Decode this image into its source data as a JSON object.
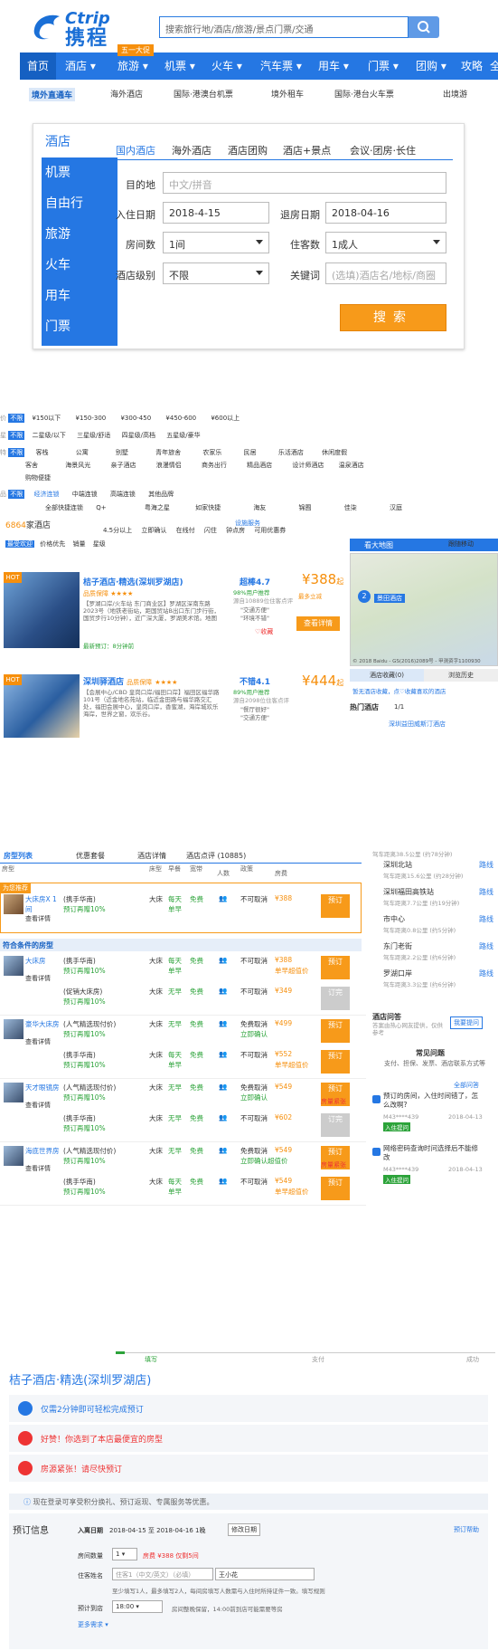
{
  "header": {
    "logo_en": "Ctrip",
    "logo_cn": "携程",
    "search_placeholder": "搜索旅行地/酒店/旅游/景点门票/交通"
  },
  "nav": {
    "items": [
      "首页",
      "酒店",
      "旅游",
      "机票",
      "火车",
      "汽车票",
      "用车",
      "门票",
      "团购",
      "攻略",
      "全"
    ],
    "badge": "五一大促"
  },
  "subnav": {
    "items": [
      "境外直通车",
      "海外酒店",
      "国际·港澳台机票",
      "境外租车",
      "国际·港台火车票",
      "出境游"
    ]
  },
  "search_panel": {
    "side": [
      "酒店",
      "机票",
      "自由行",
      "旅游",
      "火车",
      "用车",
      "门票"
    ],
    "tabs": [
      "国内酒店",
      "海外酒店",
      "酒店团购",
      "酒店+景点",
      "会议·团房·长住"
    ],
    "dest_label": "目的地",
    "dest_placeholder": "中文/拼音",
    "checkin_label": "入住日期",
    "checkin": "2018-4-15",
    "checkout_label": "退房日期",
    "checkout": "2018-04-16",
    "rooms_label": "房间数",
    "rooms": "1间",
    "guests_label": "住客数",
    "guests": "1成人",
    "level_label": "酒店级别",
    "level": "不限",
    "keyword_label": "关键词",
    "keyword_placeholder": "(选填)酒店名/地标/商圈",
    "button": "搜索"
  },
  "filters": {
    "price": [
      "不限",
      "¥150以下",
      "¥150-300",
      "¥300-450",
      "¥450-600",
      "¥600以上"
    ],
    "star": [
      "不限",
      "二星级/以下",
      "三星级/舒适",
      "四星级/高档",
      "五星级/豪华"
    ],
    "feature_row1": [
      "不限",
      "客栈",
      "公寓",
      "别墅",
      "青年旅舍",
      "农家乐",
      "民居",
      "乐活酒店",
      "休闲度假"
    ],
    "feature_row2": [
      "客舍",
      "海景风光",
      "亲子酒店",
      "浪漫情侣",
      "商务出行",
      "精品酒店",
      "设计师酒店",
      "温泉酒店"
    ],
    "feature_row3": [
      "购物便捷"
    ],
    "brand_tabs": [
      "不限",
      "经济连锁",
      "中端连锁",
      "高端连锁",
      "其他品牌"
    ],
    "brand_row": [
      "全部快捷连锁",
      "Q+",
      "粤海之星",
      "如家快捷",
      "海友",
      "锦囿",
      "佳柒",
      "汉庭"
    ],
    "count": "6864",
    "count_suffix": "家酒店",
    "more": "设施服务",
    "sortbar": [
      "4.5分以上",
      "立即确认",
      "在线付",
      "闪住",
      "钟点房",
      "可用优惠券"
    ],
    "top_tabs": [
      "最受欢迎",
      "价格优先",
      "销量",
      "星级"
    ]
  },
  "hotels": [
    {
      "name": "桔子酒店·精选(深圳罗湖店)",
      "tag": "品质保障",
      "stars": "★★★★",
      "addr": "【罗湖口岸/火车站 东门商业区】罗湖区深南东路2023号（地铁老街站，距国贸站B出口东门步行街，国贸步行10分钟），近广深大厦，罗湖美术馆。地图",
      "score_label": "超棒",
      "score": "4.7",
      "rec": "98%用户推荐",
      "reviews": "源自10889位住客点评",
      "quote1": "\"交通方便\"",
      "quote2": "\"环境不错\"",
      "price": "388",
      "price_sfx": "起",
      "coupon": "最多立减",
      "button": "查看详情",
      "fav": "收藏",
      "recent": "最新预订：8分钟前"
    },
    {
      "name": "深圳驿酒店",
      "tag": "品质保障",
      "stars": "★★★★",
      "addr": "【会展中心/CBD 皇岗口岸/福田口岸】福田区福华路101号（近金地名苑站，临近金田路与福华路交汇处，福田会展中心，皇岗口岸，香蜜湖，海岸城欢乐海岸，世界之窗，欢乐谷。",
      "score_label": "不错",
      "score": "4.1",
      "rec": "89%用户推荐",
      "reviews": "源自2098位住客点评",
      "quote1": "\"餐厅很好\"",
      "quote2": "\"交通方便\"",
      "price": "444",
      "price_sfx": "起"
    }
  ],
  "map": {
    "label": "看大地图",
    "place": "景田酒店",
    "follow": "跟随移动",
    "copyright": "© 2018 Baidu - GS(2016)2089号 - 甲测资字1100930",
    "recent_tab": "酒店收藏(0)",
    "history_tab": "浏览历史",
    "empty": "暂无酒店收藏，点♡收藏喜欢的酒店",
    "hot": "热门酒店",
    "hotpage": "1/1",
    "hot_item": "深圳益田威斯汀酒店"
  },
  "detail": {
    "tabs": [
      "房型列表",
      "优惠套餐",
      "酒店详情",
      "酒店点评 (10885)"
    ],
    "cols": [
      "房型",
      "床型",
      "早餐",
      "宽带",
      "人数",
      "政策",
      "房费"
    ],
    "featured_tag": "为您推荐",
    "featured": {
      "room": "大床房X 1间",
      "look": "查看详情",
      "src": "(携手华南)",
      "note": "预订再赠10%",
      "bed": "大床",
      "breakfast": "每天单早",
      "wifi": "免费",
      "policy": "不可取消",
      "price": "¥388",
      "btn": "预订"
    },
    "section": "符合条件的房型",
    "rooms": [
      {
        "room": "大床房",
        "look": "查看详情",
        "rows": [
          {
            "src": "(携手华南)",
            "note": "预订再赠10%",
            "bed": "大床",
            "breakfast": "每天单早",
            "wifi": "免费",
            "policy": "不可取消",
            "price": "¥388",
            "sub": "单早超值价",
            "btn": "预订",
            "gray": false
          },
          {
            "src": "(促销大床房)",
            "note": "预订再赠10%",
            "bed": "大床",
            "breakfast": "无早",
            "wifi": "免费",
            "policy": "不可取消",
            "price": "¥349",
            "sub": "",
            "btn": "订完",
            "gray": true
          }
        ]
      },
      {
        "room": "豪华大床房",
        "look": "查看详情",
        "rows": [
          {
            "src": "(人气精选现付价)",
            "note": "预订再赠10%",
            "bed": "大床",
            "breakfast": "无早",
            "wifi": "免费",
            "policy": "免费取消",
            "sub2": "立即确认",
            "price": "¥499",
            "sub": "",
            "btn": "预订",
            "gray": false
          },
          {
            "src": "(携手华南)",
            "note": "预订再赠10%",
            "bed": "大床",
            "breakfast": "每天单早",
            "wifi": "免费",
            "policy": "不可取消",
            "price": "¥552",
            "sub": "单早超值价",
            "btn": "预订",
            "gray": false
          }
        ]
      },
      {
        "room": "天才眼镜房",
        "look": "查看详情",
        "rows": [
          {
            "src": "(人气精选现付价)",
            "note": "预订再赠10%",
            "bed": "大床",
            "breakfast": "无早",
            "wifi": "免费",
            "policy": "免费取消",
            "sub2": "立即确认",
            "price": "¥549",
            "sub": "",
            "btn": "预订",
            "tag": "房量紧张",
            "gray": false
          },
          {
            "src": "(携手华南)",
            "note": "预订再赠10%",
            "bed": "大床",
            "breakfast": "无早",
            "wifi": "免费",
            "policy": "不可取消",
            "price": "¥602",
            "sub": "",
            "btn": "订完",
            "gray": true
          }
        ]
      },
      {
        "room": "海底世界房",
        "look": "查看详情",
        "rows": [
          {
            "src": "(人气精选现付价)",
            "note": "预订再赠10%",
            "bed": "大床",
            "breakfast": "无早",
            "wifi": "免费",
            "policy": "免费取消",
            "sub2": "立即确认超值价",
            "price": "¥549",
            "sub": "",
            "btn": "预订",
            "tag": "房量紧张",
            "gray": false
          },
          {
            "src": "(携手华南)",
            "note": "预订再赠10%",
            "bed": "大床",
            "breakfast": "每天单早",
            "wifi": "免费",
            "policy": "不可取消",
            "price": "¥549",
            "sub": "单早超值价",
            "btn": "预订",
            "gray": false
          }
        ]
      }
    ],
    "side": {
      "dist0": "驾车距离38.5公里 (约78分钟)",
      "stations": [
        {
          "name": "深圳北站",
          "route": "路线",
          "dist": "驾车距离15.6公里 (约28分钟)"
        },
        {
          "name": "深圳福田高铁站",
          "route": "路线",
          "dist": "驾车距离7.7公里 (约19分钟)"
        },
        {
          "name": "市中心",
          "route": "路线",
          "dist": "驾车距离0.8公里 (约5分钟)"
        },
        {
          "name": "东门老街",
          "route": "路线",
          "dist": "驾车距离2.2公里 (约6分钟)"
        },
        {
          "name": "罗湖口岸",
          "route": "路线",
          "dist": "驾车距离3.3公里 (约6分钟)"
        }
      ],
      "qa_title": "酒店问答",
      "qa_desc": "答案由热心网友提供，仅供参考",
      "ask": "我要提问",
      "faq": "常见问题",
      "faq_items": "支付、担保、发票、酒店联系方式等",
      "all_q": "全部问答",
      "qs": [
        {
          "q": "预订的房间，入住时间错了，怎么改啊?",
          "user": "M43****439",
          "date": "2018-04-13",
          "a": "入住提问"
        },
        {
          "q": "网络密码查询时问选择后不能修改",
          "user": "M43****439",
          "date": "2018-04-13",
          "a": "入住提问"
        }
      ]
    }
  },
  "booking": {
    "steps": [
      "填写",
      "支付",
      "成功"
    ],
    "hotel": "桔子酒店·精选(深圳罗湖店)",
    "tips": [
      "仅需2分钟即可轻松完成预订",
      "好赞！你选到了本店最便宜的房型",
      "房源紧张！请尽快预订"
    ],
    "login": "现在登录可享受积分换礼、预订返现、专属服务等优惠。",
    "section": "预订信息",
    "help": "预订帮助",
    "date_label": "入离日期",
    "dates": "2018-04-15 至 2018-04-16",
    "nights": "1晚",
    "change": "修改日期",
    "rooms_label": "房间数量",
    "rooms_val": "1",
    "room_note": "房费 ¥388 仅剩5间",
    "name_label": "住客姓名",
    "name_ph": "住客1（中文/英文）（必填）",
    "name_val": "王小花",
    "name_hint": "至少填写1人，最多填写2人，每间房填写人数需与入住时所持证件一致。填写规则",
    "arrive_label": "预计到店",
    "arrive_val": "18:00",
    "arrive_hint": "房间整晚保留，14:00前到店可能需要等房",
    "more": "更多需求"
  }
}
